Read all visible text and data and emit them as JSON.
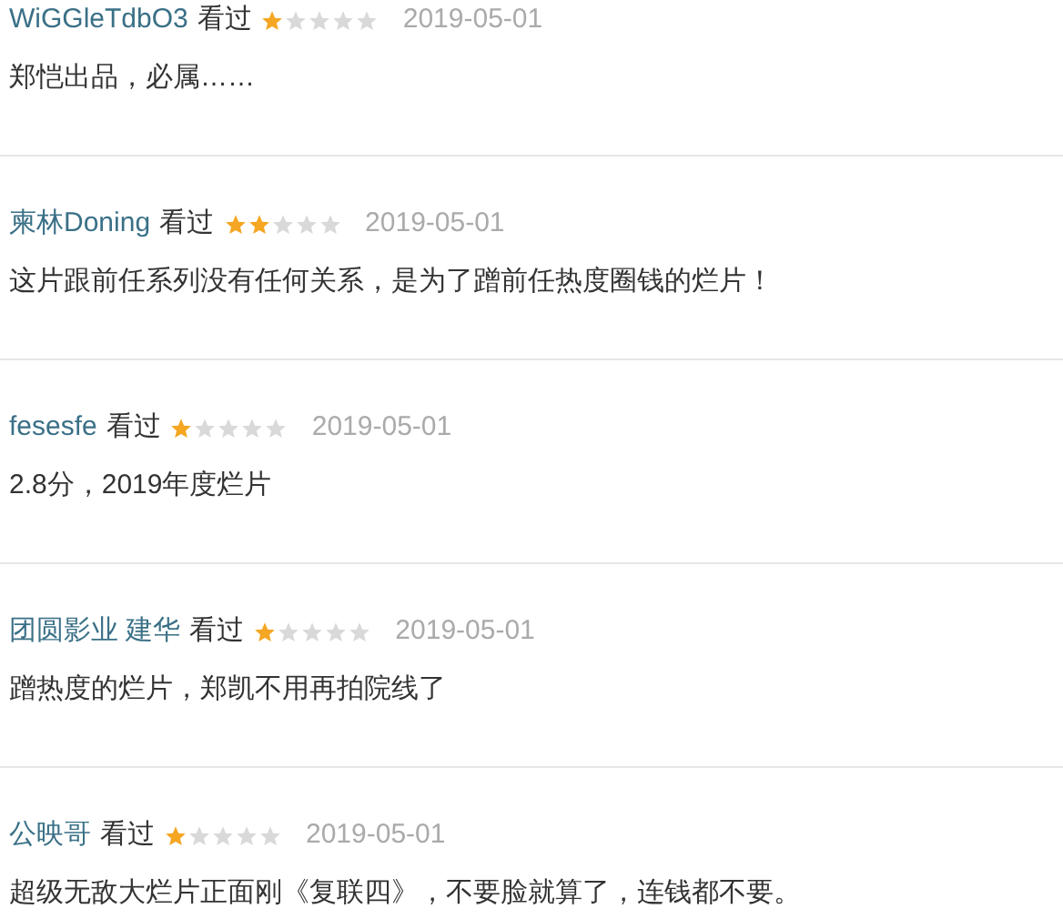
{
  "reviews": [
    {
      "user": "WiGGleTdbO3",
      "status": "看过",
      "stars": 1,
      "date": "2019-05-01",
      "comment": "郑恺出品，必属……"
    },
    {
      "user": "柬林Doning",
      "status": "看过",
      "stars": 2,
      "date": "2019-05-01",
      "comment": "这片跟前任系列没有任何关系，是为了蹭前任热度圈钱的烂片！"
    },
    {
      "user": "fesesfe",
      "status": "看过",
      "stars": 1,
      "date": "2019-05-01",
      "comment": "2.8分，2019年度烂片"
    },
    {
      "user": "团圆影业 建华",
      "status": "看过",
      "stars": 1,
      "date": "2019-05-01",
      "comment": "蹭热度的烂片，郑凯不用再拍院线了"
    },
    {
      "user": "公映哥",
      "status": "看过",
      "stars": 1,
      "date": "2019-05-01",
      "comment": "超级无敌大烂片正面刚《复联四》，不要脸就算了，连钱都不要。"
    }
  ]
}
